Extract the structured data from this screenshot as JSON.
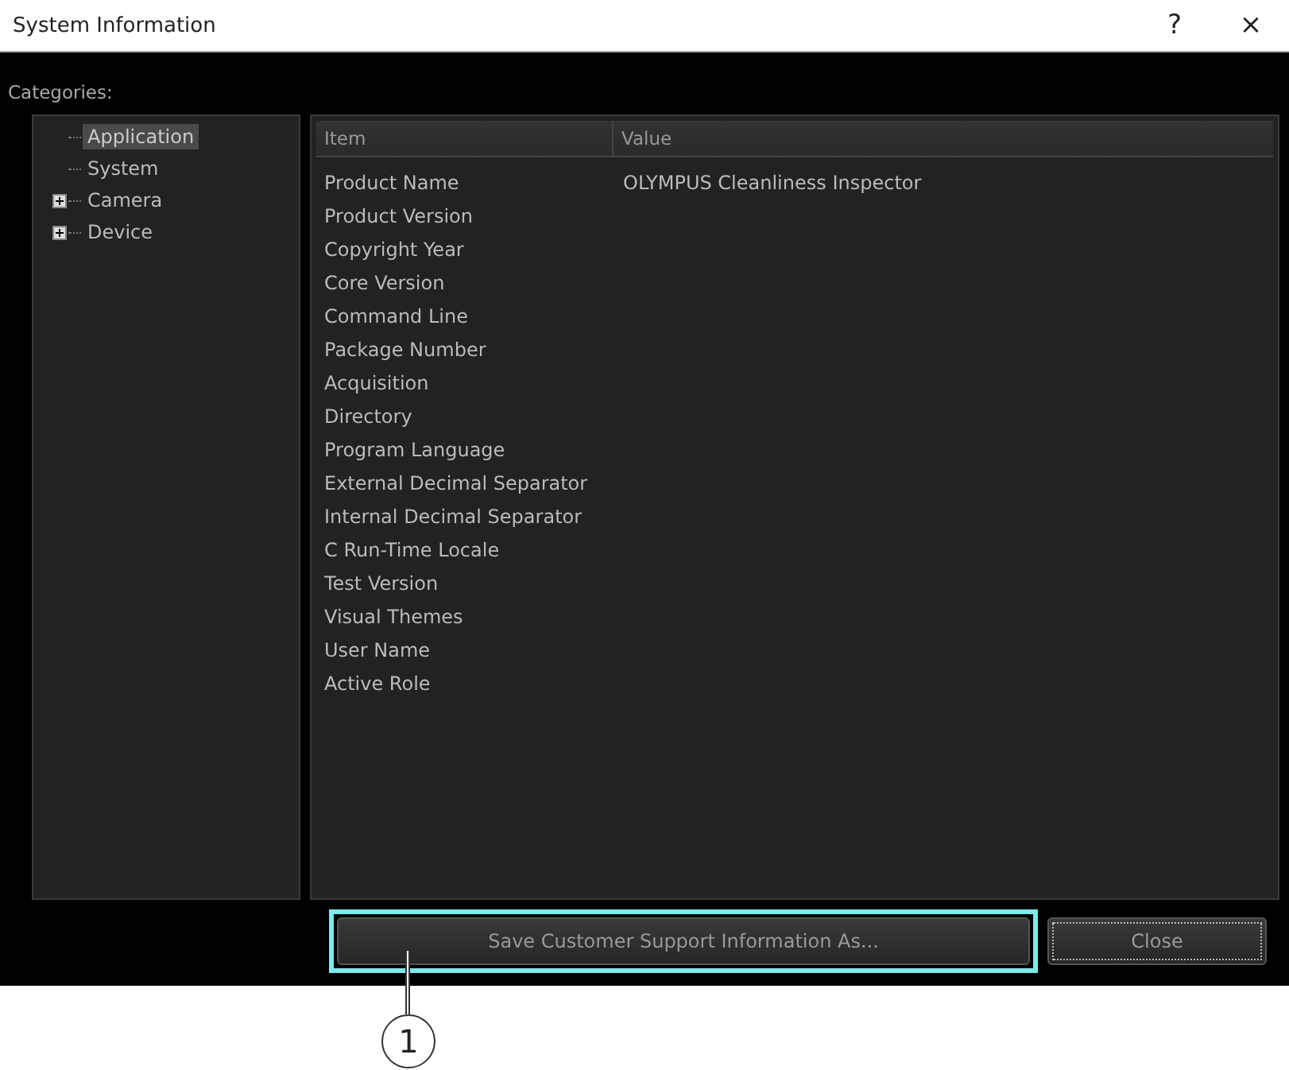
{
  "window": {
    "title": "System Information",
    "help": "?",
    "close": "×"
  },
  "categories_label": "Categories:",
  "tree": [
    {
      "label": "Application",
      "selected": true
    },
    {
      "label": "System",
      "selected": false
    },
    {
      "label": "Camera",
      "selected": false,
      "expanded": false
    },
    {
      "label": "Device",
      "selected": false,
      "expanded": false
    }
  ],
  "table": {
    "columns": [
      "Item",
      "Value"
    ],
    "rows": [
      [
        "Product Name",
        "OLYMPUS Cleanliness Inspector"
      ],
      [
        "Product Version"
      ],
      [
        "Copyright Year"
      ],
      [
        "Core Version"
      ],
      [
        "Command Line"
      ],
      [
        "Package Number"
      ],
      [
        "Acquisition"
      ],
      [
        "Directory"
      ],
      [
        "Program Language"
      ],
      [
        "External Decimal Separator"
      ],
      [
        "Internal Decimal Separator"
      ],
      [
        "C Run-Time Locale"
      ],
      [
        "Test Version"
      ],
      [
        "Visual Themes"
      ],
      [
        "User Name"
      ],
      [
        "Active Role"
      ]
    ]
  },
  "buttons": [
    {
      "label": "Save Customer Support Information As...",
      "highlighted": true
    },
    {
      "label": "Close",
      "highlighted": false
    }
  ],
  "callout": {
    "number": "1"
  }
}
